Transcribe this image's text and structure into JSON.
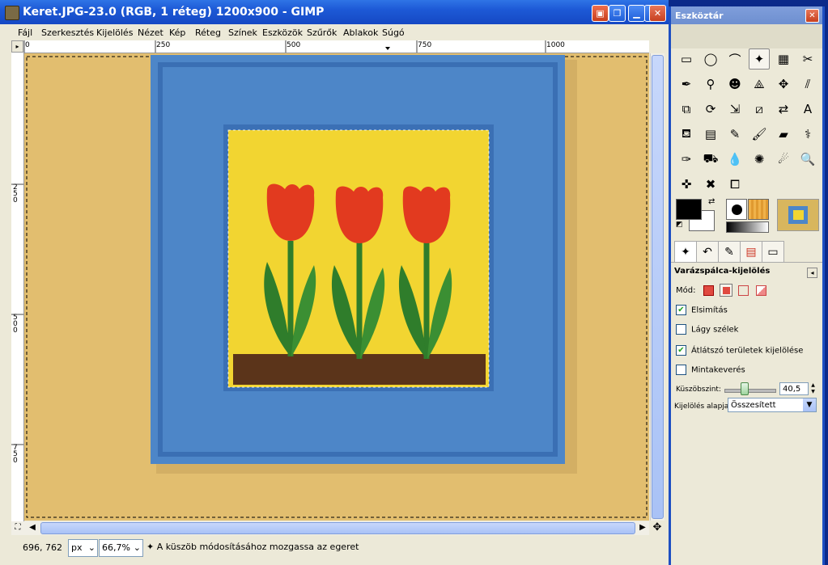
{
  "window": {
    "title": "Keret.JPG-23.0 (RGB, 1 réteg) 1200x900 - GIMP"
  },
  "menu": [
    "Fájl",
    "Szerkesztés",
    "Kijelölés",
    "Nézet",
    "Kép",
    "Réteg",
    "Színek",
    "Eszközök",
    "Szűrők",
    "Ablakok",
    "Súgó"
  ],
  "ruler": {
    "h_labels": [
      "0",
      "250",
      "500",
      "750",
      "1000"
    ],
    "v_labels": [
      "2\n5\n0",
      "5\n0\n0",
      "7\n5\n0"
    ]
  },
  "status": {
    "coords": "696, 762",
    "unit": "px",
    "zoom": "66,7%",
    "message": "A küszöb módosításához mozgassa az egeret"
  },
  "toolbox": {
    "title": "Eszköztár",
    "tools": [
      {
        "name": "rect-select-icon",
        "glyph": "▭"
      },
      {
        "name": "ellipse-select-icon",
        "glyph": "◯"
      },
      {
        "name": "free-select-icon",
        "glyph": "⌒"
      },
      {
        "name": "fuzzy-select-icon",
        "glyph": "✦",
        "active": true
      },
      {
        "name": "color-select-icon",
        "glyph": "▦"
      },
      {
        "name": "scissors-icon",
        "glyph": "✂"
      },
      {
        "name": "paths-icon",
        "glyph": "✒"
      },
      {
        "name": "color-picker-icon",
        "glyph": "⚲"
      },
      {
        "name": "zoom-people-icon",
        "glyph": "☻"
      },
      {
        "name": "measure-icon",
        "glyph": "⟁"
      },
      {
        "name": "move-icon",
        "glyph": "✥"
      },
      {
        "name": "align-icon",
        "glyph": "⫽"
      },
      {
        "name": "crop-icon",
        "glyph": "⧉"
      },
      {
        "name": "rotate-icon",
        "glyph": "⟳"
      },
      {
        "name": "scale-icon",
        "glyph": "⇲"
      },
      {
        "name": "shear-icon",
        "glyph": "⧄"
      },
      {
        "name": "flip-icon",
        "glyph": "⇄"
      },
      {
        "name": "text-tool-icon",
        "glyph": "A"
      },
      {
        "name": "bucket-fill-icon",
        "glyph": "⛾"
      },
      {
        "name": "blend-icon",
        "glyph": "▤"
      },
      {
        "name": "pencil-icon",
        "glyph": "✎"
      },
      {
        "name": "paintbrush-icon",
        "glyph": "🖌"
      },
      {
        "name": "eraser-icon",
        "glyph": "▰"
      },
      {
        "name": "airbrush-icon",
        "glyph": "⚕"
      },
      {
        "name": "ink-icon",
        "glyph": "✑"
      },
      {
        "name": "clone-icon",
        "glyph": "⛟"
      },
      {
        "name": "heal-icon",
        "glyph": "💧"
      },
      {
        "name": "perspective-clone-icon",
        "glyph": "✺"
      },
      {
        "name": "smudge-icon",
        "glyph": "☄"
      },
      {
        "name": "dodge-icon",
        "glyph": "🔍"
      },
      {
        "name": "convolve-icon",
        "glyph": "✜"
      },
      {
        "name": "cage-icon",
        "glyph": "✖"
      },
      {
        "name": "stamp-icon",
        "glyph": "⧠"
      }
    ],
    "tabs": [
      "fuzzy-select-tab-icon",
      "undo-history-tab-icon",
      "paths-tab-icon",
      "layers-tab-icon",
      "channels-tab-icon"
    ],
    "options": {
      "title": "Varázspálca-kijelölés",
      "mode_label": "Mód:",
      "antialiasing": {
        "label": "Elsimítás",
        "checked": true
      },
      "feather": {
        "label": "Lágy szélek",
        "checked": false
      },
      "transparent": {
        "label": "Átlátszó területek kijelölése",
        "checked": true
      },
      "sample_merged": {
        "label": "Mintakeverés",
        "checked": false
      },
      "threshold_label": "Küszöbszint:",
      "threshold_value": "40,5",
      "threshold_fraction": 0.16,
      "select_by_label": "Kijelölés alapja:",
      "select_by_value": "Összesített"
    }
  },
  "colors": {
    "titlebar": "#1d59d6",
    "window_bg": "#ece9d8",
    "wall": "#e2be6f",
    "frame_blue": "#4d86c8",
    "inner_yellow": "#f2d531",
    "tulip_red": "#e23a1f",
    "leaf_green": "#2f7d2b",
    "soil": "#5b341a",
    "fg_color": "#000000",
    "bg_color": "#ffffff"
  }
}
